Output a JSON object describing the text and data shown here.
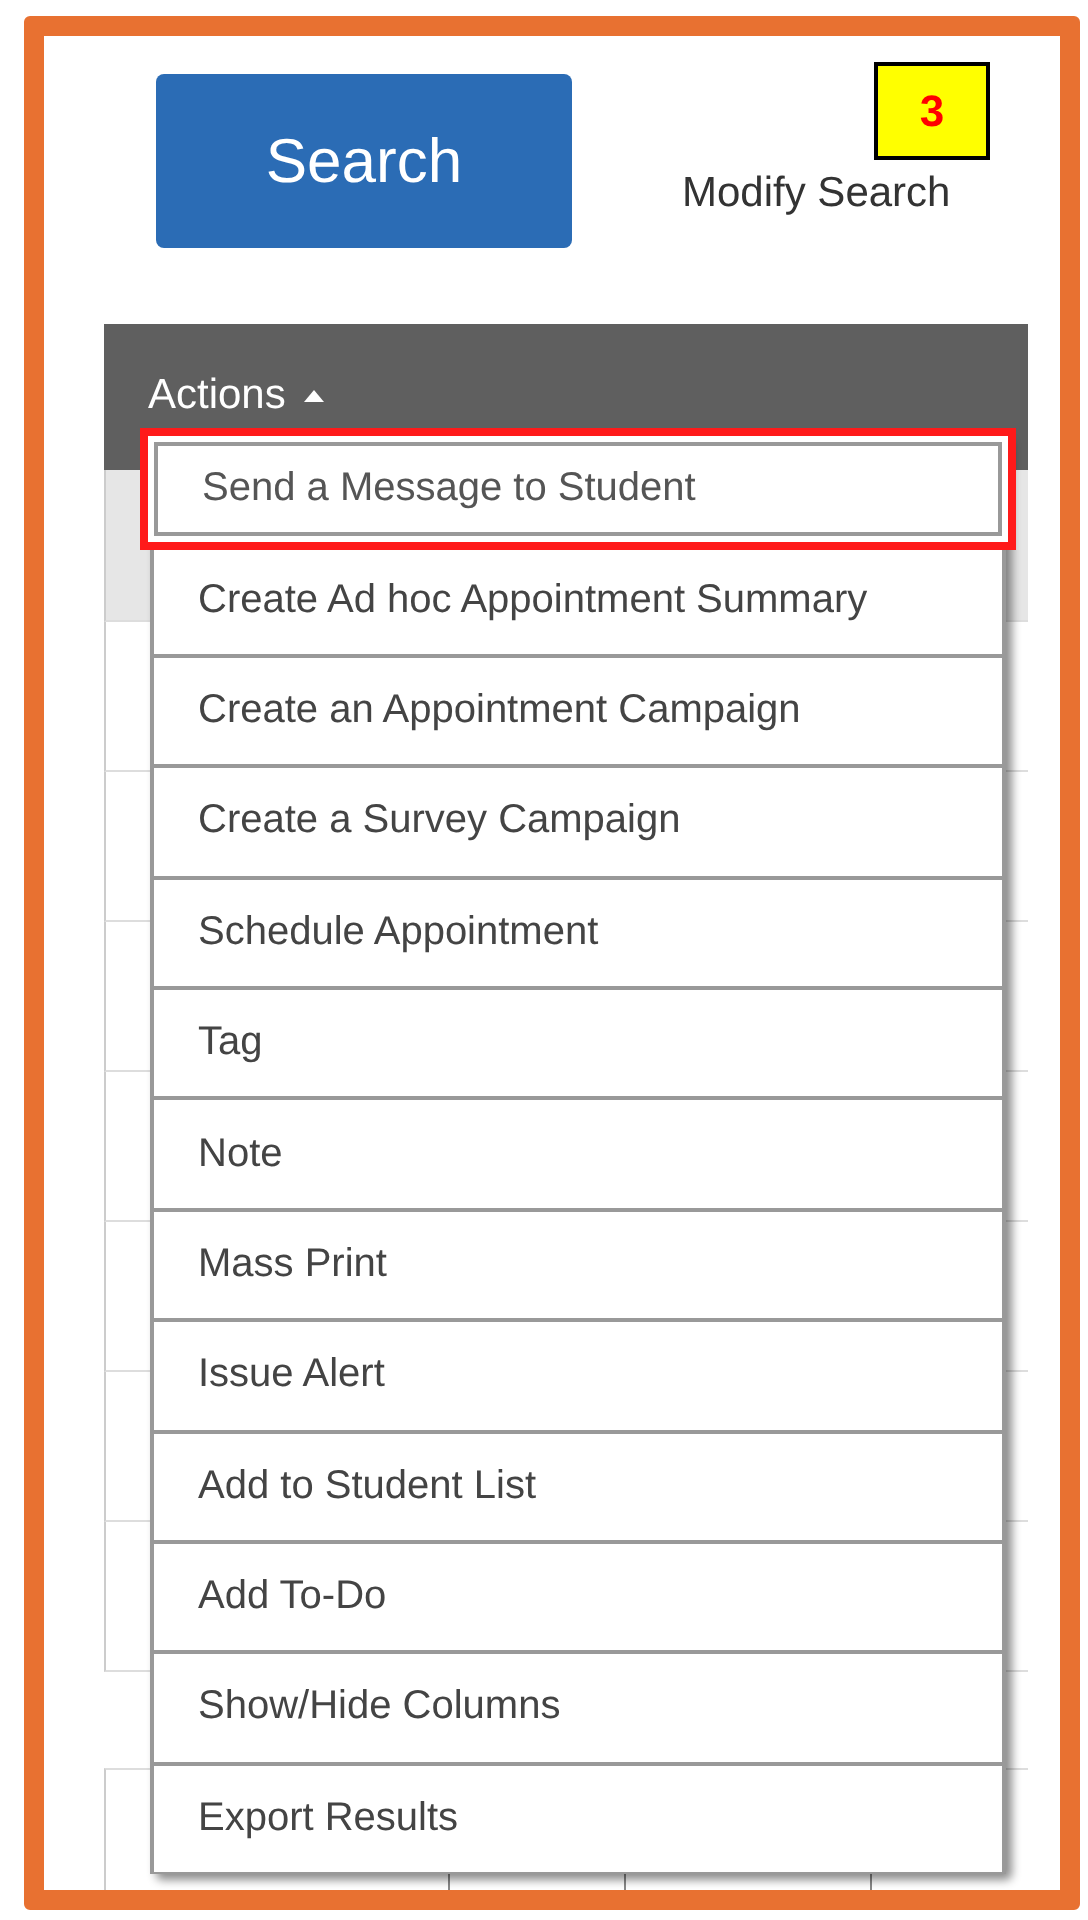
{
  "search_button": {
    "label": "Search"
  },
  "annotation_badge": {
    "label": "3"
  },
  "modify_search": {
    "label": "Modify Search"
  },
  "table": {
    "actions_header": {
      "label": "Actions",
      "expanded": true
    }
  },
  "actions_menu": [
    {
      "label": "Send a Message to Student",
      "highlighted": true
    },
    {
      "label": "Create Ad hoc Appointment Summary",
      "highlighted": false
    },
    {
      "label": "Create an Appointment Campaign",
      "highlighted": false
    },
    {
      "label": "Create a Survey Campaign",
      "highlighted": false
    },
    {
      "label": "Schedule Appointment",
      "highlighted": false
    },
    {
      "label": "Tag",
      "highlighted": false
    },
    {
      "label": "Note",
      "highlighted": false
    },
    {
      "label": "Mass Print",
      "highlighted": false
    },
    {
      "label": "Issue Alert",
      "highlighted": false
    },
    {
      "label": "Add to Student List",
      "highlighted": false
    },
    {
      "label": "Add To-Do",
      "highlighted": false
    },
    {
      "label": "Show/Hide Columns",
      "highlighted": false
    },
    {
      "label": "Export Results",
      "highlighted": false
    }
  ]
}
